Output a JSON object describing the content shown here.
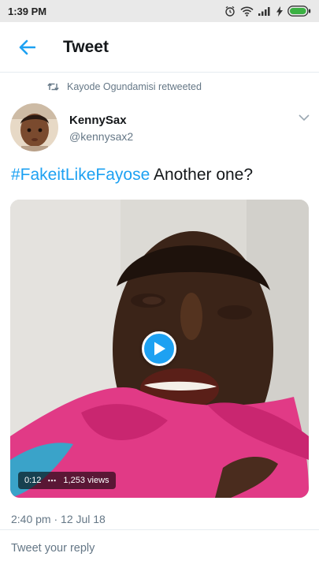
{
  "status_bar": {
    "time": "1:39 PM",
    "icons": [
      "alarm-icon",
      "wifi-icon",
      "signal-icon",
      "charging-icon",
      "battery-icon"
    ]
  },
  "header": {
    "back_icon": "arrow-left-icon",
    "title": "Tweet"
  },
  "retweet": {
    "icon": "retweet-icon",
    "text": "Kayode Ogundamisi retweeted"
  },
  "tweet": {
    "author_name": "KennySax",
    "author_handle": "@kennysax2",
    "hashtag": "#FakeitLikeFayose",
    "text_rest": " Another one?",
    "video": {
      "duration": "0:12",
      "views": "1,253 views",
      "play_icon": "play-icon"
    },
    "timestamp": "2:40 pm · 12 Jul 18"
  },
  "reply": {
    "placeholder": "Tweet your reply"
  },
  "colors": {
    "accent": "#1da1f2",
    "secondary_text": "#657786",
    "primary_text": "#14171a"
  }
}
